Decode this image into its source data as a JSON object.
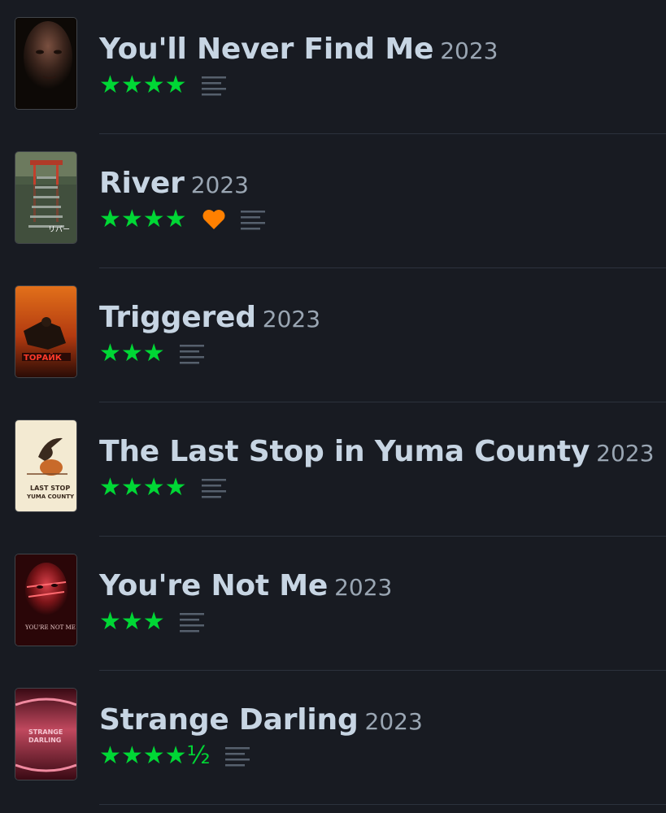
{
  "films": [
    {
      "title": "You'll Never Find Me",
      "year": "2023",
      "stars": "★★★★",
      "rating": 4,
      "liked": false,
      "has_review": true,
      "poster": "dark-face-portrait"
    },
    {
      "title": "River",
      "year": "2023",
      "stars": "★★★★",
      "rating": 4,
      "liked": true,
      "has_review": true,
      "poster": "red-shrine-stairs"
    },
    {
      "title": "Triggered",
      "year": "2023",
      "stars": "★★★",
      "rating": 3,
      "liked": false,
      "has_review": true,
      "poster": "fiery-soldier"
    },
    {
      "title": "The Last Stop in Yuma County",
      "year": "2023",
      "stars": "★★★★",
      "rating": 4,
      "liked": false,
      "has_review": true,
      "poster": "cream-bird-illustration"
    },
    {
      "title": "You're Not Me",
      "year": "2023",
      "stars": "★★★",
      "rating": 3,
      "liked": false,
      "has_review": true,
      "poster": "red-face-portrait"
    },
    {
      "title": "Strange Darling",
      "year": "2023",
      "stars": "★★★★½",
      "rating": 4.5,
      "liked": false,
      "has_review": true,
      "poster": "pink-strange-darling"
    }
  ],
  "colors": {
    "background": "#181b22",
    "star": "#00d735",
    "heart": "#ff8000",
    "review_icon": "#56606d",
    "divider": "#2c323d"
  }
}
